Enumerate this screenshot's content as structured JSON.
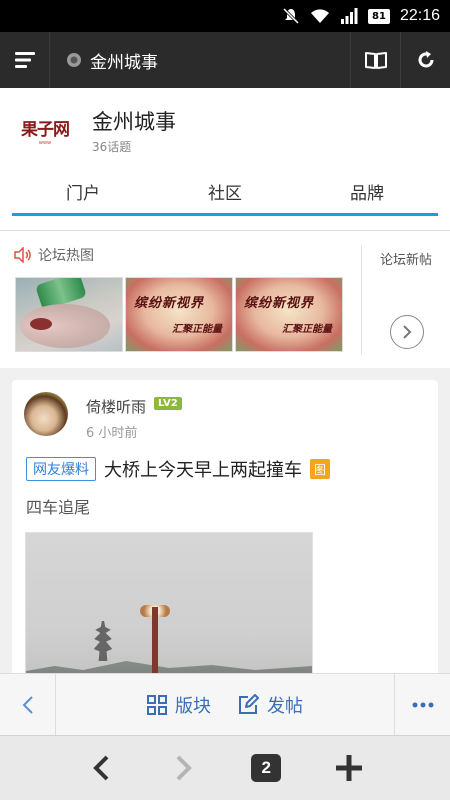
{
  "status_bar": {
    "battery": "81",
    "time": "22:16",
    "icons": [
      "mute-icon",
      "wifi-icon",
      "signal-icon",
      "battery-icon"
    ]
  },
  "browser": {
    "page_title": "金州城事",
    "icons": {
      "menu": "menu-icon",
      "site": "site-favicon",
      "reader": "book-icon",
      "refresh": "refresh-icon"
    }
  },
  "forum": {
    "logo_text": "果子网",
    "name": "金州城事",
    "topic_count": "36话题",
    "tabs": [
      "门户",
      "社区",
      "品牌"
    ],
    "active_tab": 0,
    "accent_color": "#1e9be8"
  },
  "hot_images": {
    "label": "论坛热图",
    "new_posts_label": "论坛新帖",
    "thumb_art_text": [
      "缤纷新视界",
      "汇聚正能量"
    ]
  },
  "post": {
    "username": "倚楼听雨",
    "level": "LV2",
    "time": "6 小时前",
    "tag": "网友爆料",
    "title": "大桥上今天早上两起撞车",
    "image_badge": "图",
    "excerpt": "四车追尾"
  },
  "toolbar": {
    "sections_label": "版块",
    "post_label": "发帖"
  },
  "nav": {
    "tab_count": "2"
  }
}
